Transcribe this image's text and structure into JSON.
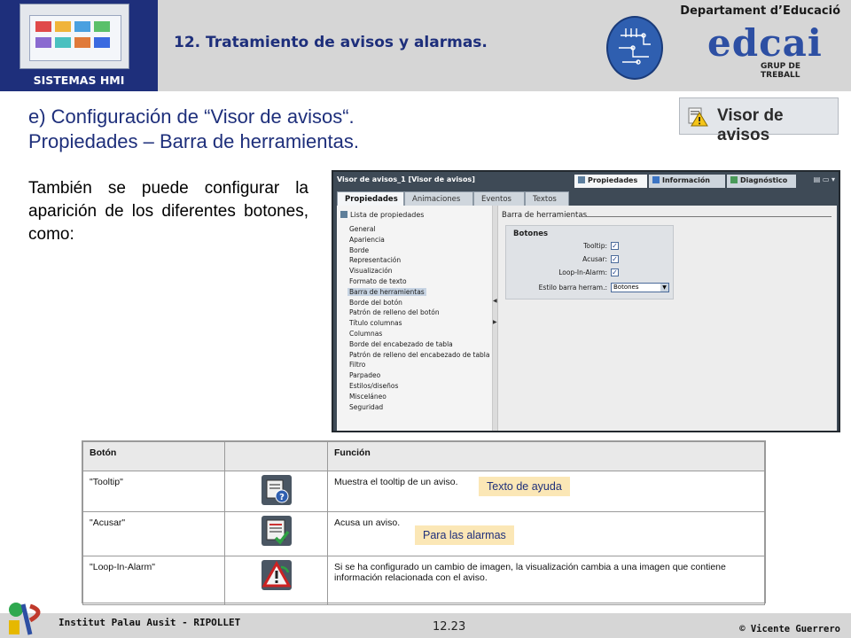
{
  "header": {
    "sistemas_label": "SISTEMAS HMI",
    "section_title": "12. Tratamiento de avisos y alarmas.",
    "department": "Departament d’Educació",
    "edcai_word": "edcai",
    "grup_label": "GRUP DE TREBALL"
  },
  "heading": {
    "line1": "e) Configuración de “Visor de avisos“.",
    "line2": "Propiedades – Barra de herramientas.",
    "badge_label": "Visor de avisos"
  },
  "body_text": "También se puede configurar la aparición de los diferentes botones, como:",
  "panel": {
    "window_title": "Visor de avisos_1 [Visor de avisos]",
    "top_tabs": [
      "Propiedades",
      "Información",
      "Diagnóstico"
    ],
    "subtabs": [
      "Propiedades",
      "Animaciones",
      "Eventos",
      "Textos"
    ],
    "list_header": "Lista de propiedades",
    "items": [
      "General",
      "Apariencia",
      "Borde",
      "Representación",
      "Visualización",
      "Formato de texto",
      "Barra de herramientas",
      "Borde del botón",
      "Patrón de relleno del botón",
      "Título columnas",
      "Columnas",
      "Borde del encabezado de tabla",
      "Patrón de relleno del encabezado de tabla",
      "Filtro",
      "Parpadeo",
      "Estilos/diseños",
      "Misceláneo",
      "Seguridad"
    ],
    "selected_item": "Barra de herramientas",
    "content_header": "Barra de herramientas",
    "group_title": "Botones",
    "options": [
      {
        "label": "Tooltip:",
        "checked": true
      },
      {
        "label": "Acusar:",
        "checked": true
      },
      {
        "label": "Loop-In-Alarm:",
        "checked": true
      }
    ],
    "style_label": "Estilo barra herram.:",
    "style_value": "Botones"
  },
  "table": {
    "headers": [
      "Botón",
      "",
      "Función"
    ],
    "rows": [
      {
        "button": "\"Tooltip\"",
        "function": "Muestra el tooltip de un aviso.",
        "icon": "tooltip-help-icon"
      },
      {
        "button": "\"Acusar\"",
        "function": "Acusa un aviso.",
        "icon": "acknowledge-check-icon"
      },
      {
        "button": "\"Loop-In-Alarm\"",
        "function": "Si se ha configurado un cambio de imagen, la visualización cambia a una imagen que contiene información relacionada con el aviso.",
        "icon": "loop-in-alarm-warning-icon"
      }
    ],
    "callouts": [
      "Texto de ayuda",
      "Para las alarmas"
    ]
  },
  "footer": {
    "institut": "Institut Palau Ausit - RIPOLLET",
    "page": "12.23",
    "author": "© Vicente Guerrero"
  },
  "colors": {
    "brand_blue": "#1e2f7b",
    "header_gray": "#d6d6d6",
    "callout_bg": "#fbe7b6",
    "panel_dark": "#3e4a56"
  }
}
